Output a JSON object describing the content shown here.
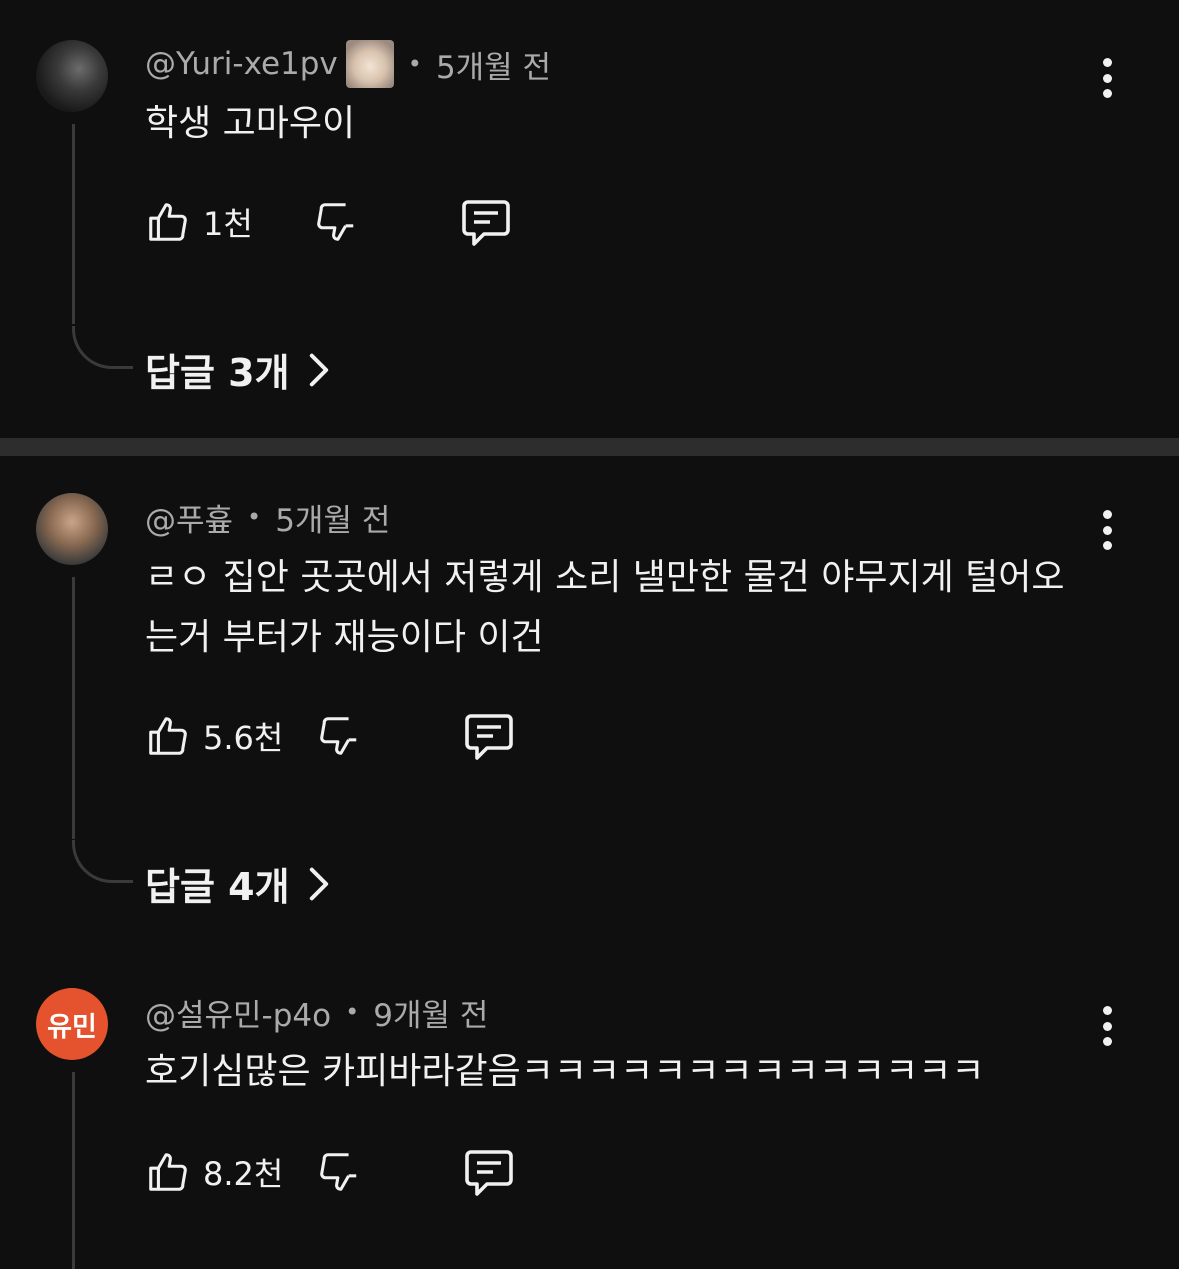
{
  "comments": [
    {
      "author": "@Yuri-xe1pv",
      "time": "5개월 전",
      "text": "학생 고마우이",
      "likes": "1천",
      "replies": "답글 3개"
    },
    {
      "author": "@푸흎",
      "time": "5개월 전",
      "text": "ㄹㅇ 집안 곳곳에서 저렇게 소리 낼만한 물건 야무지게 털어오는거 부터가 재능이다 이건",
      "likes": "5.6천",
      "replies": "답글 4개"
    },
    {
      "author": "@설유민-p4o",
      "avatar_text": "유민",
      "avatar_color": "#e4532d",
      "time": "9개월 전",
      "text": "호기심많은 카피바라같음ㅋㅋㅋㅋㅋㅋㅋㅋㅋㅋㅋㅋㅋㅋ",
      "likes": "8.2천"
    }
  ],
  "icons": {
    "like": "thumbs-up-icon",
    "dislike": "thumbs-down-icon",
    "reply": "comment-icon",
    "more": "more-vertical-icon",
    "chevron": "chevron-right-icon"
  },
  "dot": "•"
}
